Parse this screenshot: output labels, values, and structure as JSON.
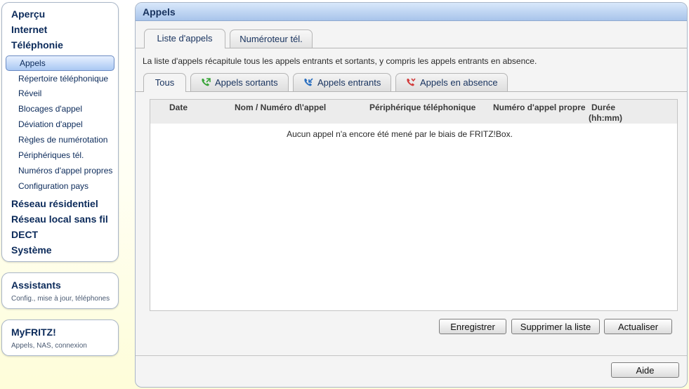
{
  "nav": {
    "overview": "Aperçu",
    "internet": "Internet",
    "telephony": "Téléphonie",
    "telephony_items": [
      "Appels",
      "Répertoire téléphonique",
      "Réveil",
      "Blocages d'appel",
      "Déviation d'appel",
      "Règles de numérotation",
      "Périphériques tél.",
      "Numéros d'appel propres",
      "Configuration pays"
    ],
    "home_network": "Réseau résidentiel",
    "wlan": "Réseau local sans fil",
    "dect": "DECT",
    "system": "Système"
  },
  "assistants": {
    "title": "Assistants",
    "subtitle": "Config., mise à jour, téléphones"
  },
  "myfritz": {
    "title": "MyFRITZ!",
    "subtitle": "Appels, NAS, connexion"
  },
  "main": {
    "title": "Appels",
    "tabs": [
      "Liste d'appels",
      "Numéroteur tél."
    ],
    "description": "La liste d'appels récapitule tous les appels entrants et sortants, y compris les appels entrants en absence.",
    "subtabs": [
      "Tous",
      "Appels sortants",
      "Appels entrants",
      "Appels en absence"
    ],
    "columns": {
      "date": "Date",
      "name": "Nom / Numéro d\\'appel",
      "device": "Périphérique téléphonique",
      "own_number": "Numéro d'appel propre",
      "duration": "Durée",
      "duration_unit": "(hh:mm)"
    },
    "empty_message": "Aucun appel n'a encore été mené par le biais de FRITZ!Box.",
    "buttons": {
      "save": "Enregistrer",
      "delete": "Supprimer la liste",
      "refresh": "Actualiser"
    },
    "help": "Aide"
  },
  "colors": {
    "outgoing_icon": "#3aa53a",
    "incoming_icon": "#2a6fc0",
    "missed_icon": "#d23b3b",
    "header_blue": "#a8c4ea"
  }
}
